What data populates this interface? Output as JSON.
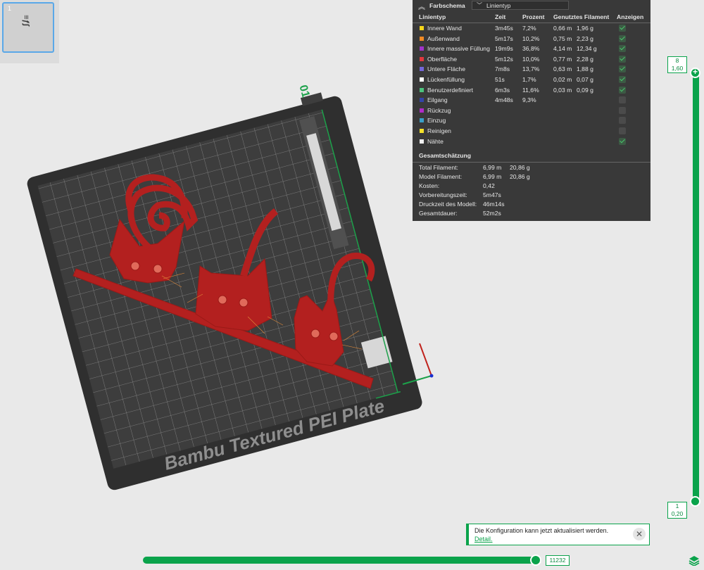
{
  "plates": [
    {
      "number": "1",
      "thumb_text": "≡ƒ∫"
    }
  ],
  "bed": {
    "plate_label": "Bambu Textured PEI Plate",
    "plate_number": "01"
  },
  "legend": {
    "title": "Farbschema",
    "scheme": "Linientyp",
    "headers": {
      "name": "Linientyp",
      "time": "Zeit",
      "percent": "Prozent",
      "filament": "Genutztes Filament",
      "show": "Anzeigen"
    },
    "rows": [
      {
        "name": "Innere Wand",
        "color": "#f5d61a",
        "time": "3m45s",
        "percent": "7,2%",
        "length": "0,66 m",
        "weight": "1,96 g",
        "show": true
      },
      {
        "name": "Außenwand",
        "color": "#f08a24",
        "time": "5m17s",
        "percent": "10,2%",
        "length": "0,75 m",
        "weight": "2,23 g",
        "show": true
      },
      {
        "name": "Innere massive Füllung",
        "color": "#a034c8",
        "time": "19m9s",
        "percent": "36,8%",
        "length": "4,14 m",
        "weight": "12,34 g",
        "show": true
      },
      {
        "name": "Oberfläche",
        "color": "#e0383e",
        "time": "5m12s",
        "percent": "10,0%",
        "length": "0,77 m",
        "weight": "2,28 g",
        "show": true
      },
      {
        "name": "Untere Fläche",
        "color": "#7466d8",
        "time": "7m8s",
        "percent": "13,7%",
        "length": "0,63 m",
        "weight": "1,88 g",
        "show": true
      },
      {
        "name": "Lückenfüllung",
        "color": "#ffffff",
        "time": "51s",
        "percent": "1,7%",
        "length": "0,02 m",
        "weight": "0,07 g",
        "show": true
      },
      {
        "name": "Benutzerdefiniert",
        "color": "#4cc27c",
        "time": "6m3s",
        "percent": "11,6%",
        "length": "0,03 m",
        "weight": "0,09 g",
        "show": true
      },
      {
        "name": "Eilgang",
        "color": "#3444a8",
        "time": "4m48s",
        "percent": "9,3%",
        "length": "",
        "weight": "",
        "show": false
      },
      {
        "name": "Rückzug",
        "color": "#b02cc8",
        "time": "",
        "percent": "",
        "length": "",
        "weight": "",
        "show": false
      },
      {
        "name": "Einzug",
        "color": "#3aa0c8",
        "time": "",
        "percent": "",
        "length": "",
        "weight": "",
        "show": false
      },
      {
        "name": "Reinigen",
        "color": "#f5e12a",
        "time": "",
        "percent": "",
        "length": "",
        "weight": "",
        "show": false
      },
      {
        "name": "Nähte",
        "color": "#f0f0f0",
        "time": "",
        "percent": "",
        "length": "",
        "weight": "",
        "show": true
      }
    ],
    "summary_title": "Gesamtschätzung",
    "summary": [
      {
        "label": "Total Filament:",
        "v1": "6,99 m",
        "v2": "20,86 g"
      },
      {
        "label": "Model Filament:",
        "v1": "6,99 m",
        "v2": "20,86 g"
      },
      {
        "label": "Kosten:",
        "v1": "0,42",
        "v2": ""
      },
      {
        "label": "Vorbereitungszeit:",
        "v1": "5m47s",
        "v2": ""
      },
      {
        "label": "Druckzeit des Modell:",
        "v1": "46m14s",
        "v2": ""
      },
      {
        "label": "Gesamtdauer:",
        "v1": "52m2s",
        "v2": ""
      }
    ]
  },
  "layer_slider": {
    "top_layer": "8",
    "top_height": "1,60",
    "bottom_layer": "1",
    "bottom_height": "0,20"
  },
  "move_slider": {
    "value": "11232"
  },
  "notification": {
    "message": "Die Konfiguration kann jetzt aktualisiert werden.",
    "link": "Detail."
  },
  "colors": {
    "accent": "#0aa34b",
    "model": "#b3201f",
    "bed": "#3d3d3d"
  }
}
